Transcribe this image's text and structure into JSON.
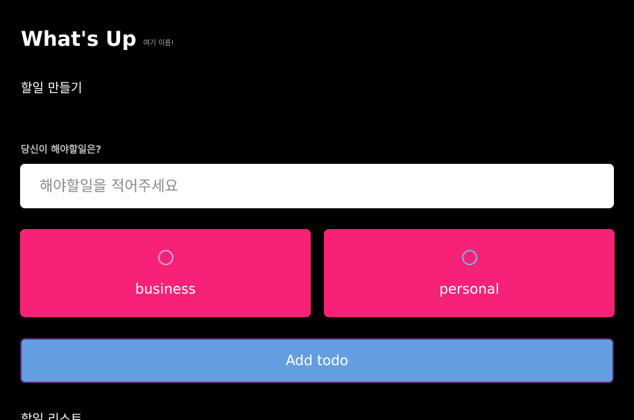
{
  "header": {
    "title": "What's Up",
    "subtitle": "여기 이름!"
  },
  "create_section": {
    "heading": "할일 만들기",
    "question_label": "당신이 해야할일은?",
    "todo_input": {
      "value": "",
      "placeholder": "해야할일을 적어주세요"
    },
    "categories": [
      {
        "label": "business",
        "selected": false,
        "color": "#f72278"
      },
      {
        "label": "personal",
        "selected": false,
        "color": "#f72278"
      }
    ],
    "add_button_label": "Add todo",
    "add_button_color": "#639ee0"
  },
  "list_section": {
    "heading": "할일 리스트"
  }
}
